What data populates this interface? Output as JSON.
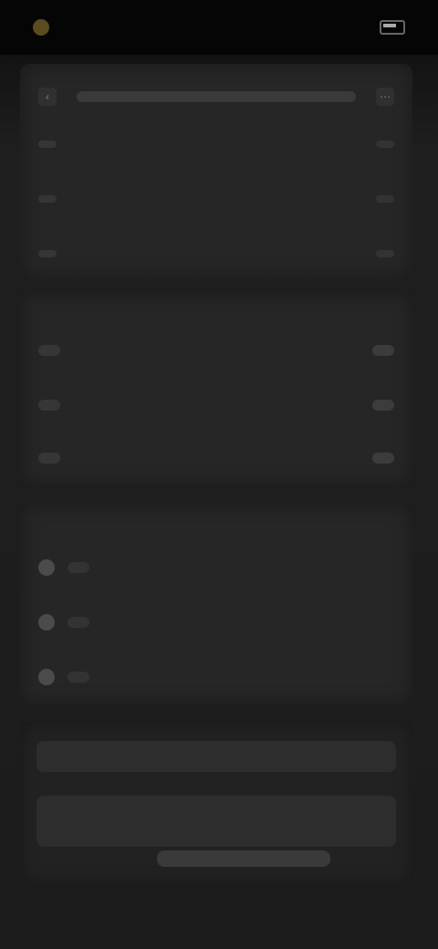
{
  "status": {
    "time": "",
    "network": "",
    "battery_icon": "battery-icon"
  },
  "header": {
    "title": ""
  },
  "summary": {
    "rows": [
      {
        "label": "",
        "value": ""
      },
      {
        "label": "",
        "value": ""
      },
      {
        "label": "",
        "value": ""
      }
    ]
  },
  "section_two": {
    "label": "",
    "rows": [
      {
        "text": "",
        "badge": ""
      },
      {
        "text": "",
        "badge": ""
      },
      {
        "text": "",
        "badge": ""
      }
    ]
  },
  "section_three": {
    "label": "",
    "options": [
      {
        "text": ""
      },
      {
        "text": ""
      },
      {
        "text": ""
      }
    ]
  },
  "footer": {
    "text1": "",
    "text2": "",
    "text3": ""
  }
}
